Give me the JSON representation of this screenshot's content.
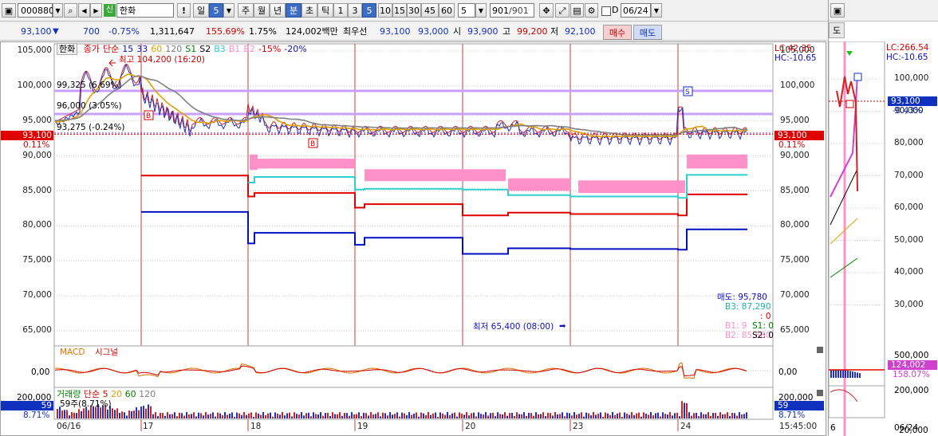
{
  "toolbar": {
    "code": "000880",
    "credit_badge": "신",
    "stock_name": "한화",
    "warn": "!",
    "period_day": "일",
    "period_num": "5",
    "week": "주",
    "month": "월",
    "year": "년",
    "minute": "분",
    "second": "초",
    "tick": "틱",
    "intervals": [
      "1",
      "3",
      "5",
      "10",
      "15",
      "30",
      "45",
      "60"
    ],
    "interval_input": "5",
    "count": "901",
    "count_total": "/901",
    "date": "06/24",
    "d_label": "D"
  },
  "infobar": {
    "price": "93,100",
    "change": "700",
    "change_pct": "-0.75%",
    "volume": "1,311,647",
    "volume_ratio": "155.69%",
    "turnover_pct": "1.75%",
    "amount": "124,002백만",
    "best_label": "최우선",
    "best_ask": "93,100",
    "best_bid": "93,000",
    "open_label": "시",
    "open": "93,900",
    "high_label": "고",
    "high": "99,200",
    "low_label": "저",
    "low": "92,100",
    "buy_button": "매수",
    "sell_button": "매도"
  },
  "right_toolbar": {
    "tab_label": "도"
  },
  "legend": {
    "name": "한화",
    "items": [
      {
        "text": "종가",
        "color": "#d00000"
      },
      {
        "text": "단순",
        "color": "#d00000"
      },
      {
        "text": "15",
        "color": "#1010c0"
      },
      {
        "text": "33",
        "color": "#1010c0"
      },
      {
        "text": "60",
        "color": "#e0a000"
      },
      {
        "text": "120",
        "color": "#808080"
      },
      {
        "text": "S1",
        "color": "#008000"
      },
      {
        "text": "S2",
        "color": "#000000"
      },
      {
        "text": "B3",
        "color": "#30d0d0"
      },
      {
        "text": "B1",
        "color": "#ff90c8"
      },
      {
        "text": "B2",
        "color": "#ff90c8"
      },
      {
        "text": "-15%",
        "color": "#d00000"
      },
      {
        "text": "-20%",
        "color": "#1010c0"
      }
    ]
  },
  "main_chart": {
    "high_annotation": "최고 104,200 (16:20)",
    "low_annotation": "최저 65,400 (08:00)",
    "level_1": "99,325 (6.69%)",
    "level_2": "96,000 (3.05%)",
    "level_3": "93,275 (-0.24%)",
    "lc": "LC:42.35",
    "hc": "HC:-10.65",
    "current_price_tag": "93,100",
    "current_pct_tag": "0.11%",
    "sell_label": "매도: 95,780",
    "b3_label": "B3: 87,290",
    "colon_zero": ": 0",
    "s1_label": "S1: 0",
    "b1_label": "B1: 9",
    "s2_label": "S2: 0",
    "b2_label": "B2: 85,680",
    "y_ticks": [
      "105,000",
      "100,000",
      "95,000",
      "90,000",
      "85,000",
      "80,000",
      "75,000",
      "70,000",
      "65,000"
    ],
    "x_ticks": [
      "06/16",
      "17",
      "18",
      "19",
      "20",
      "23",
      "24",
      "15:45:00"
    ]
  },
  "macd_panel": {
    "title_macd": "MACD",
    "title_signal": "시그널",
    "zero_label": "0,00"
  },
  "volume_panel": {
    "title": "거래량",
    "ma_label": "단순",
    "mas": [
      "5",
      "20",
      "60",
      "120"
    ],
    "ytick": "200,000",
    "info": "59주(8.71%)",
    "value_tag": "59",
    "pct_tag": "8.71%"
  },
  "right_chart": {
    "lc": "LC:266.54",
    "hc": "HC:-10.65",
    "y_ticks": [
      "100,000",
      "90,000",
      "80,000",
      "70,000",
      "60,000",
      "50,000",
      "40,000",
      "30,000"
    ],
    "price_tag": "93,100",
    "pct_tag": "-0.43%",
    "vol_ticks": [
      "500,000",
      "200,000",
      "20,000"
    ],
    "vol_tag": "124,002",
    "vol_pct_tag": "158.07%",
    "date_label": "06/24",
    "x_left": "6"
  },
  "colors": {
    "accent_blue": "#3c6cc4",
    "price_red": "#e00000",
    "grid_dotted": "#c8c8c8",
    "day_line": "#c04040",
    "pink_band": "#ff90c8",
    "cyan_line": "#30d0d0"
  }
}
